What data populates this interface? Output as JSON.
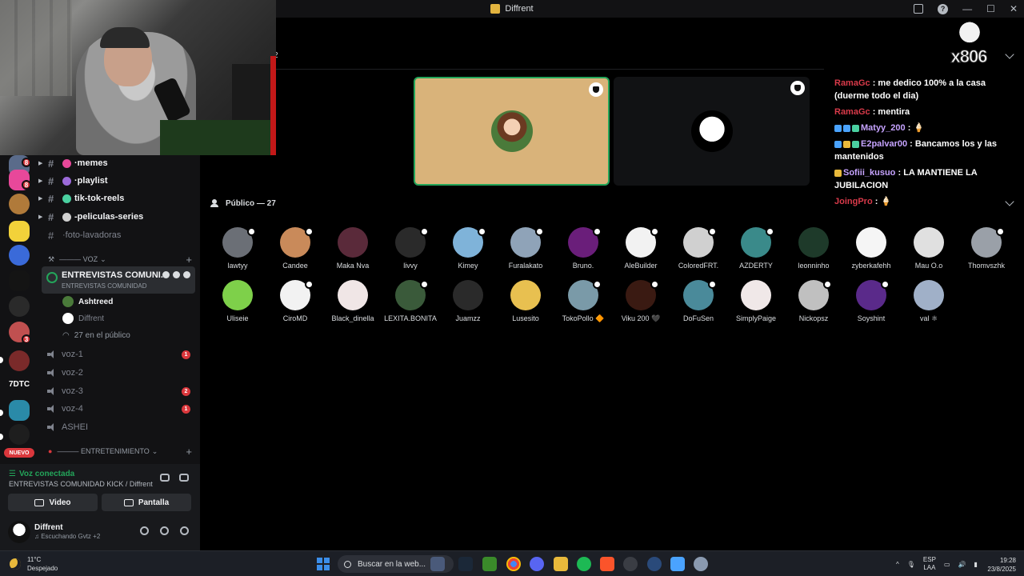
{
  "window": {
    "title": "Diffrent",
    "min_glyph": "—",
    "max_glyph": "☐",
    "close_glyph": "✕"
  },
  "stage": {
    "header_fragment": "2",
    "audience_title": "Público — 27"
  },
  "rail": {
    "badge_top": "8",
    "badge_second": "8",
    "badge_mid": "3",
    "label_7dtc": "7DTC",
    "label_nuevo": "NUEVO"
  },
  "channels": {
    "text": [
      {
        "name": "memes",
        "prefix": "· "
      },
      {
        "name": "playlist",
        "prefix": "· "
      },
      {
        "name": "tik-tok-reels",
        "prefix": ""
      },
      {
        "name": "-peliculas-series",
        "prefix": ""
      },
      {
        "name": "foto-lavadoras",
        "prefix": "· "
      }
    ],
    "voice_category": "——— VOZ",
    "active_voice": {
      "name": "ENTREVISTAS COMUNI...",
      "subtitle": "ENTREVISTAS COMUNIDAD"
    },
    "voice_users": [
      "Ashtreed",
      "Diffrent",
      "27 en el público"
    ],
    "voice_channels": [
      {
        "name": "voz-1",
        "badge": "1"
      },
      {
        "name": "voz-2",
        "badge": ""
      },
      {
        "name": "voz-3",
        "badge": "2"
      },
      {
        "name": "voz-4",
        "badge": "1"
      },
      {
        "name": "ASHEI",
        "badge": ""
      }
    ],
    "ent_category": "——— ENTRETENIMIENTO"
  },
  "voice_panel": {
    "status": "Voz conectada",
    "location": "ENTREVISTAS COMUNIDAD KICK / Diffrent",
    "video_label": "Video",
    "screen_label": "Pantalla"
  },
  "user_panel": {
    "name": "Diffrent",
    "status": "♫ Escuchando Gvtz +2"
  },
  "audience": [
    {
      "name": "lawtyy",
      "color": "#6b6f76",
      "badge": true
    },
    {
      "name": "Candee",
      "color": "#c98a5a",
      "badge": true
    },
    {
      "name": "Maka Nva",
      "color": "#5a2a3a",
      "badge": false
    },
    {
      "name": "livvy",
      "color": "#2a2a2a",
      "badge": true
    },
    {
      "name": "Kimey",
      "color": "#7fb3d9",
      "badge": true
    },
    {
      "name": "Furalakato",
      "color": "#8fa3b8",
      "badge": true
    },
    {
      "name": "Bruno.",
      "color": "#6a1e7a",
      "badge": true
    },
    {
      "name": "AleBuilder",
      "color": "#f2f2f2",
      "badge": true
    },
    {
      "name": "ColoredFRT.",
      "color": "#d0d0d0",
      "badge": true
    },
    {
      "name": "AZDERTY",
      "color": "#3a8a8a",
      "badge": true
    },
    {
      "name": "leonninho",
      "color": "#1e3a2a",
      "badge": false
    },
    {
      "name": "zyberkafehh",
      "color": "#f5f5f5",
      "badge": false
    },
    {
      "name": "Mau O.o",
      "color": "#e0e0e0",
      "badge": false
    },
    {
      "name": "Thomvszhk",
      "color": "#9aa0a8",
      "badge": true
    },
    {
      "name": "Uliseie",
      "color": "#7ed04a",
      "badge": false
    },
    {
      "name": "CiroMD",
      "color": "#f2f2f2",
      "badge": true
    },
    {
      "name": "Black_dinella",
      "color": "#f0e6e6",
      "badge": false
    },
    {
      "name": "LEXITA.BONITA",
      "color": "#3a5a3a",
      "badge": true
    },
    {
      "name": "Juamzz",
      "color": "#2a2a2a",
      "badge": false
    },
    {
      "name": "Lusesito",
      "color": "#e8c050",
      "badge": false
    },
    {
      "name": "TokoPollo 🔶",
      "color": "#7a9aa8",
      "badge": true
    },
    {
      "name": "Viku 200 🖤",
      "color": "#3a1a12",
      "badge": true
    },
    {
      "name": "DoFuSen",
      "color": "#4a8a9a",
      "badge": true
    },
    {
      "name": "SimplyPaige",
      "color": "#f0e8e8",
      "badge": false
    },
    {
      "name": "Nickopsz",
      "color": "#c0c0c0",
      "badge": true
    },
    {
      "name": "Soyshint",
      "color": "#5a2a8a",
      "badge": true
    },
    {
      "name": "val ⚛",
      "color": "#a0b0c8",
      "badge": false
    }
  ],
  "chat": {
    "brand": "x806",
    "messages": [
      {
        "user": "RamaGc",
        "user_color": "#d93a4a",
        "text": " me dedico 100% a la casa (duerme todo el dia)",
        "tags": []
      },
      {
        "user": "RamaGc",
        "user_color": "#d93a4a",
        "text": " mentira",
        "tags": []
      },
      {
        "user": "Matyy_200",
        "user_color": "#c6a3ff",
        "text": " 🍦",
        "tags": [
          "#4aa3ff",
          "#4aa3ff",
          "#4ad0a0"
        ]
      },
      {
        "user": "E2palvar00",
        "user_color": "#c6a3ff",
        "text": " Bancamos los y las mantenidos",
        "tags": [
          "#4aa3ff",
          "#e8b93b",
          "#4ad0a0"
        ]
      },
      {
        "user": "Sofiii_kusuo",
        "user_color": "#c6a3ff",
        "text": " LA MANTIENE LA JUBILACION",
        "tags": [
          "#e8b93b"
        ]
      },
      {
        "user": "JoingPro",
        "user_color": "#d93a4a",
        "text": " 🍦",
        "tags": []
      }
    ]
  },
  "taskbar": {
    "temp": "11°C",
    "weather": "Despejado",
    "search_placeholder": "Buscar en la web...",
    "lang1": "ESP",
    "lang2": "LAA",
    "time": "19:28",
    "date": "23/8/2025",
    "tray_up": "^"
  }
}
